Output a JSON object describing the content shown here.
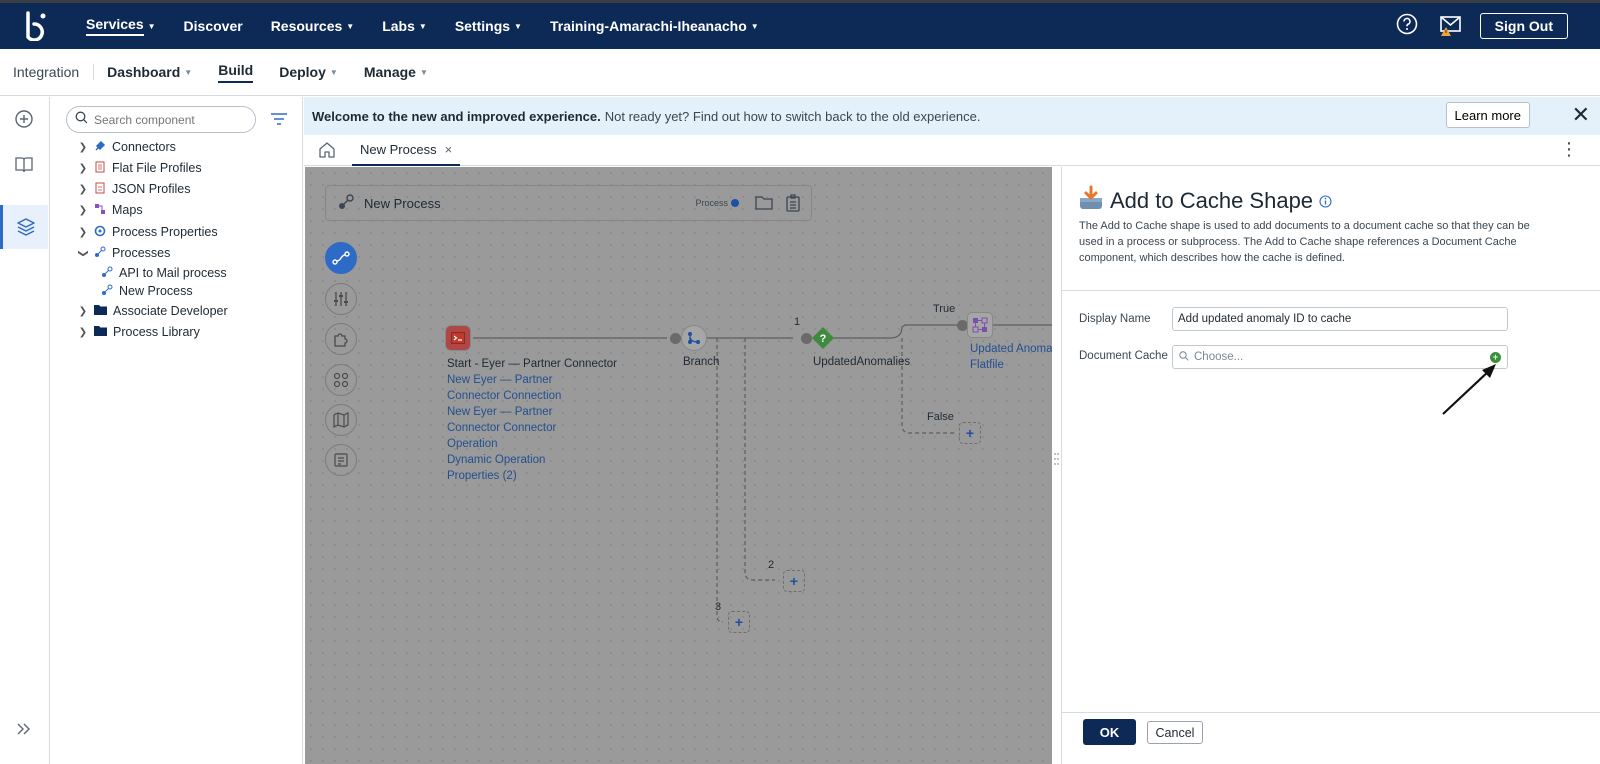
{
  "topnav": {
    "items": [
      {
        "label": "Services"
      },
      {
        "label": "Discover"
      },
      {
        "label": "Resources"
      },
      {
        "label": "Labs"
      },
      {
        "label": "Settings"
      },
      {
        "label": "Training-Amarachi-Iheanacho"
      }
    ],
    "sign_out": "Sign Out"
  },
  "subnav": {
    "section": "Integration",
    "items": [
      {
        "label": "Dashboard"
      },
      {
        "label": "Build"
      },
      {
        "label": "Deploy"
      },
      {
        "label": "Manage"
      }
    ]
  },
  "tree": {
    "search_placeholder": "Search component",
    "items": [
      {
        "label": "Connectors"
      },
      {
        "label": "Flat File Profiles"
      },
      {
        "label": "JSON Profiles"
      },
      {
        "label": "Maps"
      },
      {
        "label": "Process Properties"
      },
      {
        "label": "Processes"
      },
      {
        "label": "API to Mail process"
      },
      {
        "label": "New Process"
      },
      {
        "label": "Associate Developer"
      },
      {
        "label": "Process Library"
      }
    ]
  },
  "banner": {
    "bold": "Welcome to the new and improved experience.",
    "message": "Not ready yet? Find out how to switch back to the old experience.",
    "learn_more": "Learn more"
  },
  "tabs": {
    "active": "New Process",
    "close": "×"
  },
  "canvas": {
    "process_title": "New Process",
    "process_badge": "Process",
    "start_label": "Start - Eyer — Partner Connector",
    "start_links": [
      "New Eyer — Partner",
      "Connector Connection",
      "New Eyer — Partner",
      "Connector Connector",
      "Operation",
      "Dynamic Operation",
      "Properties (2)"
    ],
    "branch_label": "Branch",
    "decision_label": "UpdatedAnomalies",
    "true_label": "True",
    "false_label": "False",
    "map_links": [
      "Updated Anoma",
      "Flatfile"
    ],
    "branch_numbers": [
      "1",
      "2",
      "3"
    ],
    "add_symbol": "+"
  },
  "panel": {
    "title": "Add to Cache Shape",
    "description": "The Add to Cache shape is used to add documents to a document cache so that they can be used in a process or subprocess. The Add to Cache shape references a Document Cache component, which describes how the cache is defined.",
    "display_name_label": "Display Name",
    "display_name_value": "Add updated anomaly ID to cache",
    "document_cache_label": "Document Cache",
    "document_cache_placeholder": "Choose...",
    "ok": "OK",
    "cancel": "Cancel"
  },
  "colors": {
    "nav_bg": "#0d2a57",
    "accent": "#2e6bc6",
    "banner_bg": "#e4f1fb",
    "canvas_overlay": "#9a9a9a"
  }
}
